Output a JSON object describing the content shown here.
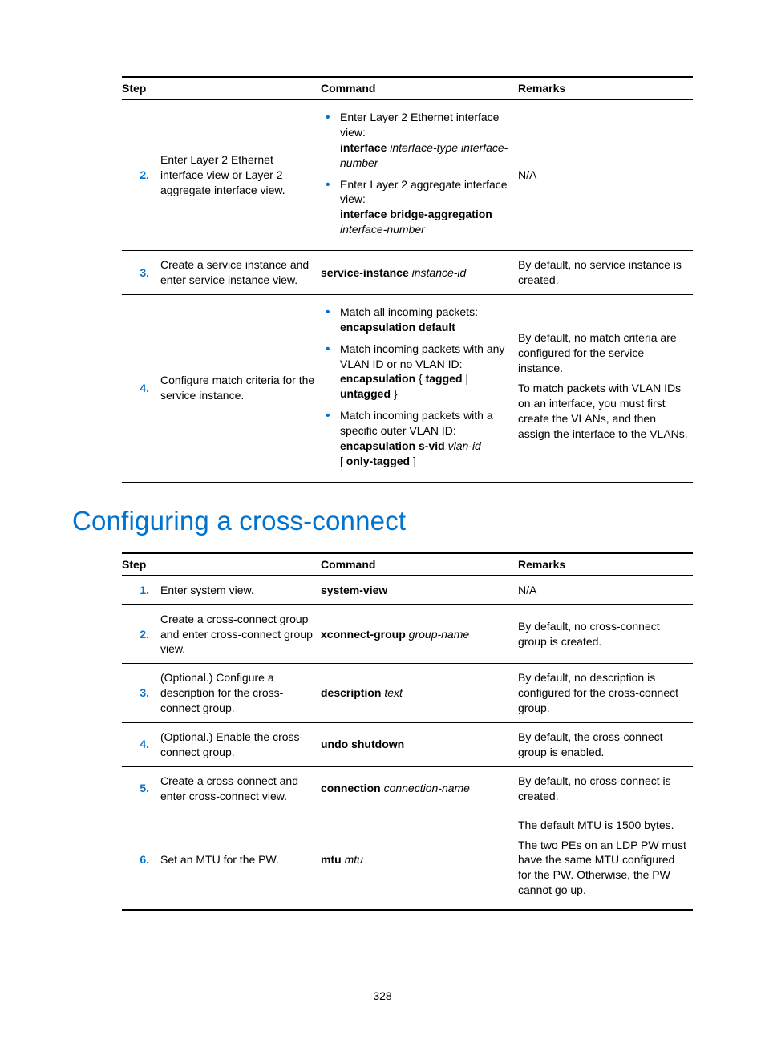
{
  "tables": {
    "t1": {
      "headers": [
        "Step",
        "Command",
        "Remarks"
      ],
      "rows": [
        {
          "num": "2.",
          "desc": "Enter Layer 2 Ethernet interface view or Layer 2 aggregate interface view.",
          "cmd": {
            "bullets": [
              {
                "pre": "Enter Layer 2 Ethernet interface view:",
                "line2_b": "interface",
                "line2_i": "interface-type interface-number"
              },
              {
                "pre": "Enter Layer 2 aggregate interface view:",
                "line2_b": "interface bridge-aggregation",
                "line2_i": "interface-number"
              }
            ]
          },
          "remarks": "N/A"
        },
        {
          "num": "3.",
          "desc": "Create a service instance and enter service instance view.",
          "cmd_b": "service-instance",
          "cmd_i": "instance-id",
          "remarks": "By default, no service instance is created."
        },
        {
          "num": "4.",
          "desc": "Configure match criteria for the service instance.",
          "cmd": {
            "bullets": [
              {
                "pre": "Match all incoming packets:",
                "line2_b": "encapsulation default"
              },
              {
                "pre": "Match incoming packets with any VLAN ID or no VLAN ID:",
                "line2_b1": "encapsulation",
                "line2_s1": " { ",
                "line2_b2": "tagged",
                "line2_s2": " | ",
                "line2_b3": "untagged",
                "line2_s3": " }"
              },
              {
                "pre": "Match incoming packets with a specific outer VLAN ID:",
                "line2_b1": "encapsulation s-vid",
                "line2_i1": "vlan-id",
                "line3_s1": "[ ",
                "line3_b1": "only-tagged",
                "line3_s2": " ]"
              }
            ]
          },
          "remarks_p1": "By default, no match criteria are configured for the service instance.",
          "remarks_p2": "To match packets with VLAN IDs on an interface, you must first create the VLANs, and then assign the interface to the VLANs."
        }
      ]
    },
    "t2": {
      "headers": [
        "Step",
        "Command",
        "Remarks"
      ],
      "rows": [
        {
          "num": "1.",
          "desc": "Enter system view.",
          "cmd_b": "system-view",
          "remarks": "N/A"
        },
        {
          "num": "2.",
          "desc": "Create a cross-connect group and enter cross-connect group view.",
          "cmd_b": "xconnect-group",
          "cmd_i": "group-name",
          "remarks": "By default, no cross-connect group is created."
        },
        {
          "num": "3.",
          "desc": "(Optional.) Configure a description for the cross-connect group.",
          "cmd_b": "description",
          "cmd_i": "text",
          "remarks": "By default, no description is configured for the cross-connect group."
        },
        {
          "num": "4.",
          "desc": "(Optional.) Enable the cross-connect group.",
          "cmd_b": "undo shutdown",
          "remarks": "By default, the cross-connect group is enabled."
        },
        {
          "num": "5.",
          "desc": "Create a cross-connect and enter cross-connect view.",
          "cmd_b": "connection",
          "cmd_i": "connection-name",
          "remarks": "By default, no cross-connect is created."
        },
        {
          "num": "6.",
          "desc": "Set an MTU for the PW.",
          "cmd_b": "mtu",
          "cmd_i": "mtu",
          "remarks_p1": "The default MTU is 1500 bytes.",
          "remarks_p2": "The two PEs on an LDP PW must have the same MTU configured for the PW. Otherwise, the PW cannot go up."
        }
      ]
    }
  },
  "heading": "Configuring a cross-connect",
  "page_number": "328"
}
